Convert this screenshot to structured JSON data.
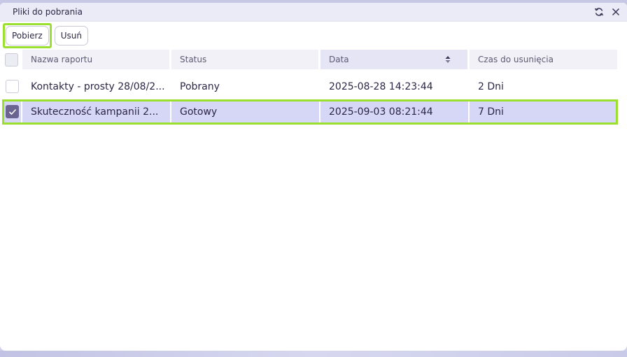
{
  "window": {
    "title": "Pliki do pobrania",
    "icons": [
      "refresh-icon",
      "close-icon"
    ]
  },
  "toolbar": {
    "download_label": "Pobierz",
    "delete_label": "Usuń"
  },
  "table": {
    "columns": [
      "Nazwa raportu",
      "Status",
      "Data",
      "Czas do usunięcia"
    ],
    "sorted_column": "Data",
    "rows": [
      {
        "name": "Kontakty - prosty 28/08/2...",
        "status": "Pobrany",
        "date": "2025-08-28 14:23:44",
        "ttl": "2 Dni",
        "checked": false,
        "selected": false
      },
      {
        "name": "Skuteczność kampanii 2...",
        "status": "Gotowy",
        "date": "2025-09-03 08:21:44",
        "ttl": "7 Dni",
        "checked": true,
        "selected": true
      }
    ]
  },
  "colors": {
    "highlight": "#9be02e",
    "selected_row": "#d6d6f7",
    "checkbox_checked": "#6b6491",
    "header_bg": "#f1f1f7",
    "titlebar_bg": "#ebebf7"
  }
}
